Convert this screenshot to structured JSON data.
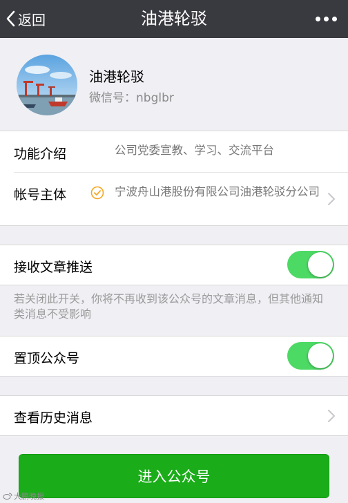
{
  "navbar": {
    "back_label": "返回",
    "title": "油港轮驳"
  },
  "profile": {
    "name": "油港轮驳",
    "wechat_id": "微信号：nbglbr"
  },
  "info": {
    "intro_label": "功能介绍",
    "intro_value": "公司党委宣教、学习、交流平台",
    "owner_label": "帐号主体",
    "owner_value": "宁波舟山港股份有限公司油港轮驳分公司"
  },
  "settings": {
    "push_label": "接收文章推送",
    "push_on": true,
    "push_hint": "若关闭此开关，你将不再收到该公众号的文章消息，但其他通知类消息不受影响",
    "pin_label": "置顶公众号",
    "pin_on": true
  },
  "history": {
    "label": "查看历史消息"
  },
  "enter_button": {
    "label": "进入公众号"
  },
  "watermark": {
    "text": "大鹏晚报"
  },
  "colors": {
    "navbar": "#393a3f",
    "toggle_on": "#4cd964",
    "primary_button": "#1aad19",
    "verified": "#f5a623"
  },
  "icons": {
    "back": "chevron-left-icon",
    "more": "more-dots-icon",
    "verified": "verified-badge-icon",
    "row_arrow": "chevron-right-icon"
  }
}
